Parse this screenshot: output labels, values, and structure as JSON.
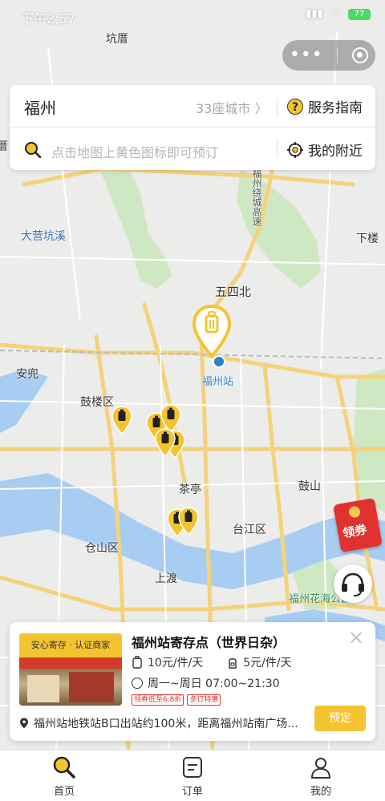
{
  "status_bar": {
    "time": "下午2:57",
    "battery": "77"
  },
  "search": {
    "city": "福州",
    "city_count": "33座城市",
    "guide_label": "服务指南",
    "placeholder": "点击地图上黄色图标即可预订",
    "nearby_label": "我的附近"
  },
  "map": {
    "labels": {
      "kengcuo": "坑厝",
      "dayingkengxi": "大营坑溪",
      "xialou": "下楼",
      "wusibei": "五四北",
      "fuzhou_station": "福州站",
      "anmian": "安兜",
      "gulou": "鼓楼区",
      "chating": "茶亭",
      "gushan": "鼓山",
      "taijiang": "台江区",
      "cangshan": "仓山区",
      "shangdu": "上渡",
      "huahai_park": "福州花海公园",
      "road_label": "福州绕城高速",
      "left_edge": "厝"
    }
  },
  "coupon": {
    "label": "领券"
  },
  "shop": {
    "photo_tag": "安心寄存 · 认证商家",
    "name": "福州站寄存点（世界日杂）",
    "price_large": "10元/件/天",
    "price_small": "5元/件/天",
    "hours": "周一~周日 07:00~21:30",
    "badges": [
      "领券低至6.8折",
      "多订特惠"
    ],
    "address": "福州站地铁站B口出站约100米，距离福州站南广场...",
    "book_label": "预定"
  },
  "tabs": [
    {
      "label": "首页",
      "icon": "search-icon"
    },
    {
      "label": "订单",
      "icon": "order-icon"
    },
    {
      "label": "我的",
      "icon": "user-icon"
    }
  ],
  "colors": {
    "brand_yellow": "#f4c430",
    "coupon_red": "#e0322f",
    "station_blue": "#2d7fd3"
  }
}
